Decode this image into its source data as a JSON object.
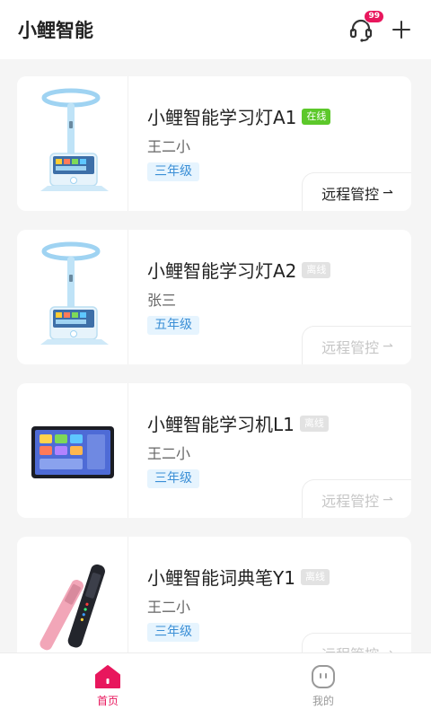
{
  "header": {
    "title": "小鲤智能",
    "support_badge": "99"
  },
  "devices": [
    {
      "name": "小鲤智能学习灯A1",
      "status": "在线",
      "status_type": "online",
      "owner": "王二小",
      "grade": "三年级",
      "action": "远程管控",
      "action_enabled": true,
      "icon": "desk-lamp-icon"
    },
    {
      "name": "小鲤智能学习灯A2",
      "status": "离线",
      "status_type": "offline",
      "owner": "张三",
      "grade": "五年级",
      "action": "远程管控",
      "action_enabled": false,
      "icon": "desk-lamp-icon"
    },
    {
      "name": "小鲤智能学习机L1",
      "status": "离线",
      "status_type": "offline",
      "owner": "王二小",
      "grade": "三年级",
      "action": "远程管控",
      "action_enabled": false,
      "icon": "tablet-icon"
    },
    {
      "name": "小鲤智能词典笔Y1",
      "status": "离线",
      "status_type": "offline",
      "owner": "王二小",
      "grade": "三年级",
      "action": "远程管控",
      "action_enabled": false,
      "icon": "dictionary-pen-icon"
    }
  ],
  "tabs": [
    {
      "label": "首页",
      "active": true,
      "icon": "home-icon"
    },
    {
      "label": "我的",
      "active": false,
      "icon": "profile-icon"
    }
  ],
  "colors": {
    "accent": "#e8175d",
    "online": "#5cc82a",
    "offline": "#e2e2e2",
    "grade_bg": "#e6f4fe",
    "grade_text": "#3b8fd6"
  }
}
